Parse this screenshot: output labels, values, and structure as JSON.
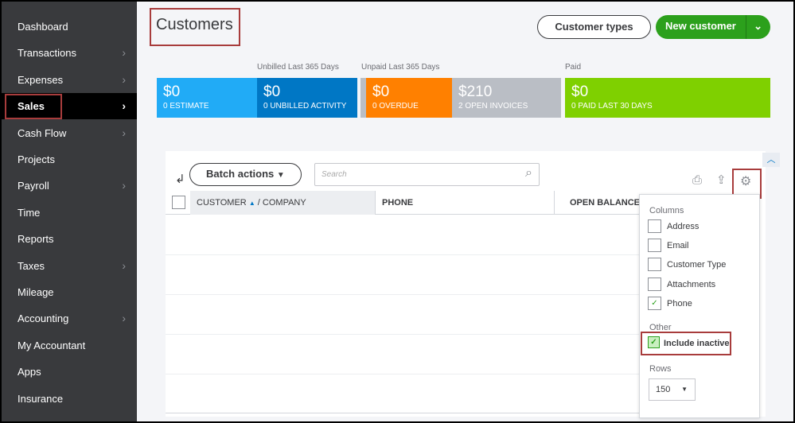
{
  "sidebar": {
    "items": [
      {
        "label": "Dashboard",
        "chevron": false
      },
      {
        "label": "Transactions",
        "chevron": true
      },
      {
        "label": "Expenses",
        "chevron": true
      },
      {
        "label": "Sales",
        "chevron": true,
        "active": true
      },
      {
        "label": "Cash Flow",
        "chevron": true
      },
      {
        "label": "Projects",
        "chevron": false
      },
      {
        "label": "Payroll",
        "chevron": true
      },
      {
        "label": "Time",
        "chevron": false
      },
      {
        "label": "Reports",
        "chevron": false
      },
      {
        "label": "Taxes",
        "chevron": true
      },
      {
        "label": "Mileage",
        "chevron": false
      },
      {
        "label": "Accounting",
        "chevron": true
      },
      {
        "label": "My Accountant",
        "chevron": false
      },
      {
        "label": "Apps",
        "chevron": false
      },
      {
        "label": "Insurance",
        "chevron": false
      }
    ]
  },
  "header": {
    "title": "Customers",
    "customer_types": "Customer types",
    "new_customer": "New customer"
  },
  "summary": {
    "labels": {
      "unbilled": "Unbilled Last 365 Days",
      "unpaid": "Unpaid Last 365 Days",
      "paid": "Paid"
    },
    "tiles": [
      {
        "value": "$0",
        "sub": "0 ESTIMATE",
        "color": "#21abf6"
      },
      {
        "value": "$0",
        "sub": "0 UNBILLED ACTIVITY",
        "color": "#0077c5"
      },
      {
        "value": "$0",
        "sub": "0 OVERDUE",
        "color": "#ff8000"
      },
      {
        "value": "$210",
        "sub": "2 OPEN INVOICES",
        "color": "#babec5"
      },
      {
        "value": "$0",
        "sub": "0 PAID LAST 30 DAYS",
        "color": "#7fd000"
      }
    ]
  },
  "toolbar": {
    "batch_actions": "Batch actions",
    "search_placeholder": "Search"
  },
  "table": {
    "columns": {
      "customer": "CUSTOMER",
      "company": "/ COMPANY",
      "phone": "PHONE",
      "open_balance": "OPEN BALANCE"
    }
  },
  "settings": {
    "columns_heading": "Columns",
    "columns": [
      {
        "label": "Address",
        "checked": false
      },
      {
        "label": "Email",
        "checked": false
      },
      {
        "label": "Customer Type",
        "checked": false
      },
      {
        "label": "Attachments",
        "checked": false
      },
      {
        "label": "Phone",
        "checked": true
      }
    ],
    "other_heading": "Other",
    "include_inactive": "Include inactive",
    "include_inactive_checked": true,
    "rows_heading": "Rows",
    "rows_value": "150"
  }
}
